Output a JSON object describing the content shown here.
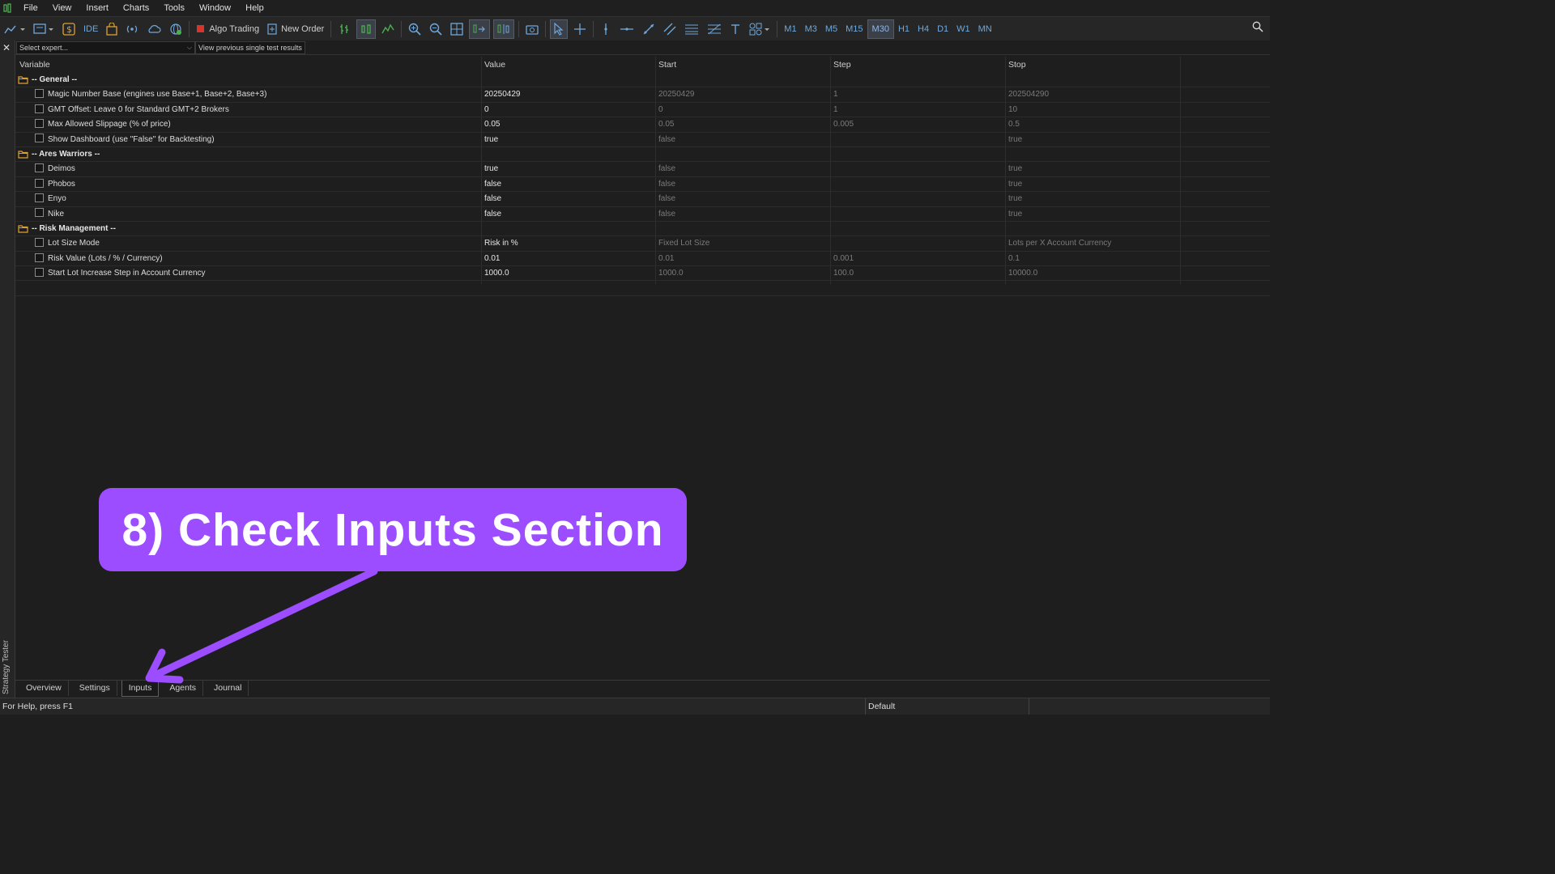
{
  "menu": [
    "File",
    "View",
    "Insert",
    "Charts",
    "Tools",
    "Window",
    "Help"
  ],
  "toolbar": {
    "ide_label": "IDE",
    "algo_trading_label": "Algo Trading",
    "new_order_label": "New Order",
    "timeframes": [
      "M1",
      "M3",
      "M5",
      "M15",
      "M30",
      "H1",
      "H4",
      "D1",
      "W1",
      "MN"
    ],
    "active_timeframe": "M30"
  },
  "expert_bar": {
    "select_placeholder": "Select expert...",
    "view_previous_label": "View previous single test results"
  },
  "columns": [
    "Variable",
    "Value",
    "Start",
    "Step",
    "Stop"
  ],
  "rows": [
    {
      "type": "group",
      "variable": "-- General --"
    },
    {
      "type": "param",
      "variable": "Magic Number Base (engines use Base+1, Base+2, Base+3)",
      "value": "20250429",
      "start": "20250429",
      "step": "1",
      "stop": "202504290"
    },
    {
      "type": "param",
      "variable": "GMT Offset: Leave 0 for Standard GMT+2 Brokers",
      "value": "0",
      "start": "0",
      "step": "1",
      "stop": "10"
    },
    {
      "type": "param",
      "variable": "Max Allowed Slippage (% of price)",
      "value": "0.05",
      "start": "0.05",
      "step": "0.005",
      "stop": "0.5"
    },
    {
      "type": "param",
      "variable": "Show Dashboard (use \"False\" for Backtesting)",
      "value": "true",
      "start": "false",
      "step": "",
      "stop": "true"
    },
    {
      "type": "group",
      "variable": "-- Ares Warriors --"
    },
    {
      "type": "param",
      "variable": "Deimos",
      "value": "true",
      "start": "false",
      "step": "",
      "stop": "true"
    },
    {
      "type": "param",
      "variable": "Phobos",
      "value": "false",
      "start": "false",
      "step": "",
      "stop": "true"
    },
    {
      "type": "param",
      "variable": "Enyo",
      "value": "false",
      "start": "false",
      "step": "",
      "stop": "true"
    },
    {
      "type": "param",
      "variable": "Nike",
      "value": "false",
      "start": "false",
      "step": "",
      "stop": "true"
    },
    {
      "type": "group",
      "variable": "-- Risk Management --"
    },
    {
      "type": "param",
      "variable": "Lot Size Mode",
      "value": "Risk in %",
      "start": "Fixed Lot Size",
      "step": "",
      "stop": "Lots per X Account Currency"
    },
    {
      "type": "param",
      "variable": "Risk Value (Lots / % / Currency)",
      "value": "0.01",
      "start": "0.01",
      "step": "0.001",
      "stop": "0.1"
    },
    {
      "type": "param",
      "variable": "Start Lot Increase Step in Account Currency",
      "value": "1000.0",
      "start": "1000.0",
      "step": "100.0",
      "stop": "10000.0"
    }
  ],
  "bottom_tabs": [
    "Overview",
    "Settings",
    "Inputs",
    "Agents",
    "Journal"
  ],
  "active_tab": "Inputs",
  "side_label": "Strategy Tester",
  "status": {
    "help": "For Help, press F1",
    "profile": "Default"
  },
  "callout": {
    "text": "8) Check Inputs Section",
    "color": "#9b4dff"
  }
}
